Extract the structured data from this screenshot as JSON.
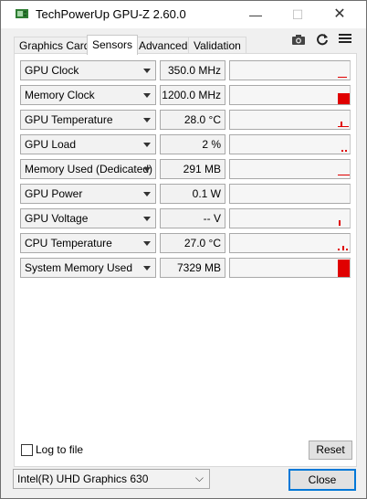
{
  "window": {
    "title": "TechPowerUp GPU-Z 2.60.0",
    "minimize_glyph": "—",
    "maximize_glyph": "☐",
    "close_glyph": "✕"
  },
  "tabs": [
    {
      "label": "Graphics Card",
      "active": false
    },
    {
      "label": "Sensors",
      "active": true
    },
    {
      "label": "Advanced",
      "active": false
    },
    {
      "label": "Validation",
      "active": false
    }
  ],
  "tab_icons": {
    "camera": "camera-icon",
    "refresh": "refresh-icon",
    "menu": "menu-icon"
  },
  "sensors": [
    {
      "name": "GPU Clock",
      "value": "350.0 MHz"
    },
    {
      "name": "Memory Clock",
      "value": "1200.0 MHz"
    },
    {
      "name": "GPU Temperature",
      "value": "28.0 °C"
    },
    {
      "name": "GPU Load",
      "value": "2 %"
    },
    {
      "name": "Memory Used (Dedicated)",
      "value": "291 MB"
    },
    {
      "name": "GPU Power",
      "value": "0.1 W"
    },
    {
      "name": "GPU Voltage",
      "value": "-- V"
    },
    {
      "name": "CPU Temperature",
      "value": "27.0 °C"
    },
    {
      "name": "System Memory Used",
      "value": "7329 MB"
    }
  ],
  "footer": {
    "log_to_file_label": "Log to file",
    "log_to_file_checked": false,
    "reset_label": "Reset",
    "device_selected": "Intel(R) UHD Graphics 630",
    "close_label": "Close"
  },
  "colors": {
    "graph_line": "#e00000",
    "focus_border": "#0078d7"
  }
}
